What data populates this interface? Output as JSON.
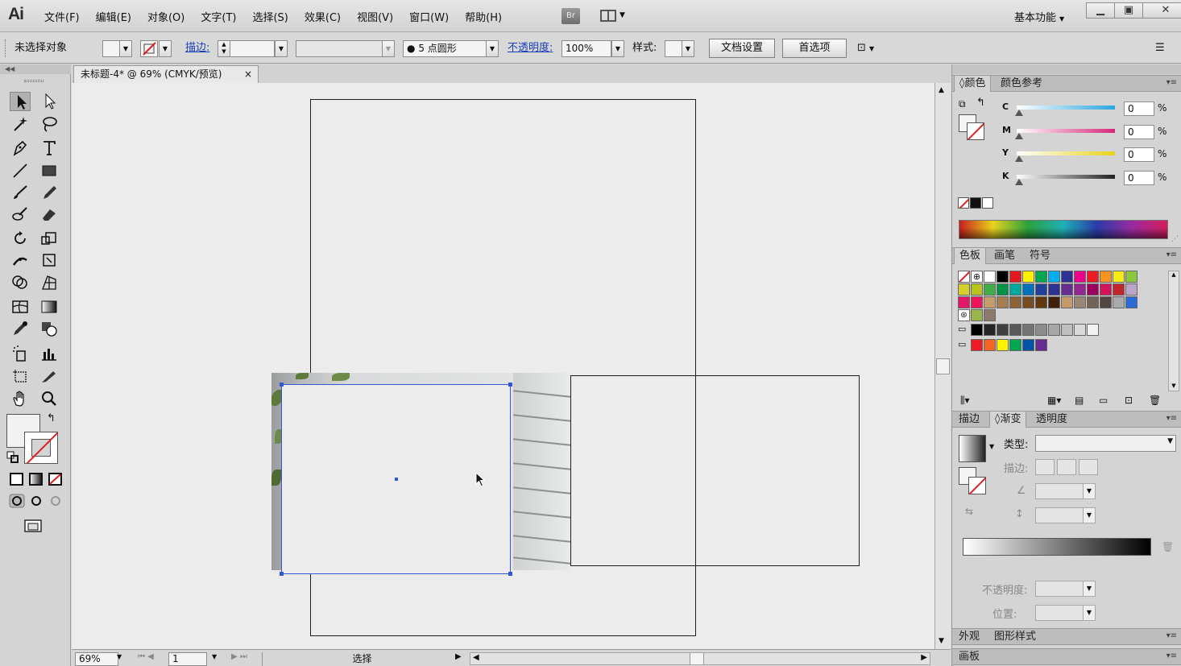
{
  "app": {
    "logo": "Ai"
  },
  "menu": [
    "文件(F)",
    "编辑(E)",
    "对象(O)",
    "文字(T)",
    "选择(S)",
    "效果(C)",
    "视图(V)",
    "窗口(W)",
    "帮助(H)"
  ],
  "bridge_label": "Br",
  "workspace": "基本功能",
  "window_buttons": {
    "minimize": "▁",
    "restore": "▣",
    "close": "✕"
  },
  "control": {
    "selection_status": "未选择对象",
    "stroke_label": "描边:",
    "brush_size": "5",
    "brush_shape": "点圆形",
    "opacity_label": "不透明度:",
    "opacity_value": "100%",
    "style_label": "样式:",
    "doc_setup_button": "文档设置",
    "preferences_button": "首选项"
  },
  "document": {
    "tab_title": "未标题-4* @ 69% (CMYK/预览)",
    "tab_close": "×"
  },
  "status": {
    "zoom": "69%",
    "page": "1",
    "tool_status": "选择"
  },
  "color_panel": {
    "tabs": [
      "颜色",
      "颜色参考"
    ],
    "channels": [
      {
        "label": "C",
        "value": "0",
        "gradient": "#2aa6e0",
        "unit": "%"
      },
      {
        "label": "M",
        "value": "0",
        "gradient": "#d6287a",
        "unit": "%"
      },
      {
        "label": "Y",
        "value": "0",
        "gradient": "#e8d31a",
        "unit": "%"
      },
      {
        "label": "K",
        "value": "0",
        "gradient": "#222222",
        "unit": "%"
      }
    ]
  },
  "swatch_panel": {
    "tabs": [
      "色板",
      "画笔",
      "符号"
    ]
  },
  "gradient_panel": {
    "tabs": [
      "描边",
      "渐变",
      "透明度"
    ],
    "type_label": "类型:",
    "stroke_label": "描边:",
    "opacity_label": "不透明度:",
    "position_label": "位置:"
  },
  "appearance_panel": {
    "tabs": [
      "外观",
      "图形样式"
    ]
  },
  "artboard_panel": {
    "tabs": [
      "画板"
    ]
  },
  "colors": {
    "selection": "#3458d4",
    "accent": "#1a3fb8"
  }
}
